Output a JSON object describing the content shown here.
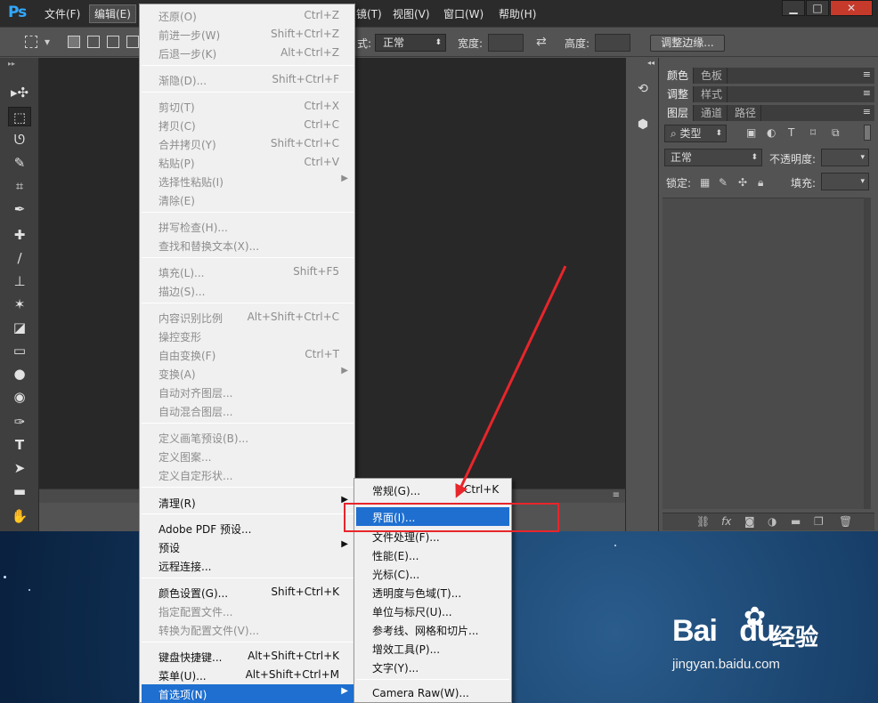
{
  "app": {
    "logo": "Ps"
  },
  "menubar": {
    "items": [
      "文件(F)",
      "编辑(E)",
      "镜(T)",
      "视图(V)",
      "窗口(W)",
      "帮助(H)"
    ],
    "window_buttons": [
      "▁",
      "□",
      "✕"
    ]
  },
  "options_bar": {
    "mode_label": "式:",
    "mode_value": "正常",
    "width_label": "宽度:",
    "height_label": "高度:",
    "refine_button": "调整边缘..."
  },
  "toolbar": {
    "tools": [
      "move-tool",
      "marquee-tool",
      "lasso-tool",
      "quick-selection-tool",
      "crop-tool",
      "eyedropper-tool",
      "healing-brush-tool",
      "brush-tool",
      "clone-stamp-tool",
      "history-brush-tool",
      "eraser-tool",
      "gradient-tool",
      "blur-tool",
      "dodge-tool",
      "pen-tool",
      "type-tool",
      "path-selection-tool",
      "rectangle-tool",
      "hand-tool"
    ],
    "glyphs": [
      "▸✣",
      "⬚",
      "ᘎ",
      "✎",
      "⌗",
      "✒",
      "✚",
      "∕",
      "⊥",
      "✶",
      "◪",
      "▭",
      "●",
      "◉",
      "✑",
      "T",
      "➤",
      "▬",
      "✋"
    ]
  },
  "panels": {
    "row1_tabs": [
      "颜色",
      "色板"
    ],
    "row2_tabs": [
      "调整",
      "样式"
    ],
    "row3_tabs": [
      "图层",
      "通道",
      "路径"
    ],
    "filter_kind": "类型",
    "blend_mode": "正常",
    "opacity_label": "不透明度:",
    "lock_label": "锁定:",
    "fill_label": "填充:",
    "panel_menu_icon": "≡",
    "collapse_icon": "◂◂"
  },
  "edit_menu": {
    "items": [
      {
        "label": "还原(O)",
        "shortcut": "Ctrl+Z",
        "enabled": false
      },
      {
        "label": "前进一步(W)",
        "shortcut": "Shift+Ctrl+Z",
        "enabled": false
      },
      {
        "label": "后退一步(K)",
        "shortcut": "Alt+Ctrl+Z",
        "enabled": false
      },
      {
        "label": "渐隐(D)...",
        "shortcut": "Shift+Ctrl+F",
        "enabled": false
      },
      {
        "label": "剪切(T)",
        "shortcut": "Ctrl+X",
        "enabled": false
      },
      {
        "label": "拷贝(C)",
        "shortcut": "Ctrl+C",
        "enabled": false
      },
      {
        "label": "合并拷贝(Y)",
        "shortcut": "Shift+Ctrl+C",
        "enabled": false
      },
      {
        "label": "粘贴(P)",
        "shortcut": "Ctrl+V",
        "enabled": false
      },
      {
        "label": "选择性粘贴(I)",
        "shortcut": "",
        "enabled": false,
        "submenu": true
      },
      {
        "label": "清除(E)",
        "shortcut": "",
        "enabled": false
      },
      {
        "label": "拼写检查(H)...",
        "shortcut": "",
        "enabled": false
      },
      {
        "label": "查找和替换文本(X)...",
        "shortcut": "",
        "enabled": false
      },
      {
        "label": "填充(L)...",
        "shortcut": "Shift+F5",
        "enabled": false
      },
      {
        "label": "描边(S)...",
        "shortcut": "",
        "enabled": false
      },
      {
        "label": "内容识别比例",
        "shortcut": "Alt+Shift+Ctrl+C",
        "enabled": false
      },
      {
        "label": "操控变形",
        "shortcut": "",
        "enabled": false
      },
      {
        "label": "自由变换(F)",
        "shortcut": "Ctrl+T",
        "enabled": false
      },
      {
        "label": "变换(A)",
        "shortcut": "",
        "enabled": false,
        "submenu": true
      },
      {
        "label": "自动对齐图层...",
        "shortcut": "",
        "enabled": false
      },
      {
        "label": "自动混合图层...",
        "shortcut": "",
        "enabled": false
      },
      {
        "label": "定义画笔预设(B)...",
        "shortcut": "",
        "enabled": false
      },
      {
        "label": "定义图案...",
        "shortcut": "",
        "enabled": false
      },
      {
        "label": "定义自定形状...",
        "shortcut": "",
        "enabled": false
      },
      {
        "label": "清理(R)",
        "shortcut": "",
        "enabled": true,
        "submenu": true
      },
      {
        "label": "Adobe PDF 预设...",
        "shortcut": "",
        "enabled": true
      },
      {
        "label": "预设",
        "shortcut": "",
        "enabled": true,
        "submenu": true
      },
      {
        "label": "远程连接...",
        "shortcut": "",
        "enabled": true
      },
      {
        "label": "颜色设置(G)...",
        "shortcut": "Shift+Ctrl+K",
        "enabled": true
      },
      {
        "label": "指定配置文件...",
        "shortcut": "",
        "enabled": false
      },
      {
        "label": "转换为配置文件(V)...",
        "shortcut": "",
        "enabled": false
      },
      {
        "label": "键盘快捷键...",
        "shortcut": "Alt+Shift+Ctrl+K",
        "enabled": true
      },
      {
        "label": "菜单(U)...",
        "shortcut": "Alt+Shift+Ctrl+M",
        "enabled": true
      },
      {
        "label": "首选项(N)",
        "shortcut": "",
        "enabled": true,
        "submenu": true,
        "highlighted": true
      }
    ]
  },
  "preferences_submenu": {
    "items": [
      {
        "label": "常规(G)...",
        "shortcut": "Ctrl+K"
      },
      {
        "label": "界面(I)...",
        "shortcut": "",
        "highlighted": true
      },
      {
        "label": "文件处理(F)...",
        "shortcut": ""
      },
      {
        "label": "性能(E)...",
        "shortcut": ""
      },
      {
        "label": "光标(C)...",
        "shortcut": ""
      },
      {
        "label": "透明度与色域(T)...",
        "shortcut": ""
      },
      {
        "label": "单位与标尺(U)...",
        "shortcut": ""
      },
      {
        "label": "参考线、网格和切片...",
        "shortcut": ""
      },
      {
        "label": "增效工具(P)...",
        "shortcut": ""
      },
      {
        "label": "文字(Y)...",
        "shortcut": ""
      },
      {
        "label": "Camera Raw(W)...",
        "shortcut": ""
      }
    ]
  },
  "annotation": {
    "highlight_color": "#e8252b"
  },
  "watermark": {
    "brand": "Bai",
    "brand2": "du",
    "cn": "经验",
    "url": "jingyan.baidu.com"
  }
}
